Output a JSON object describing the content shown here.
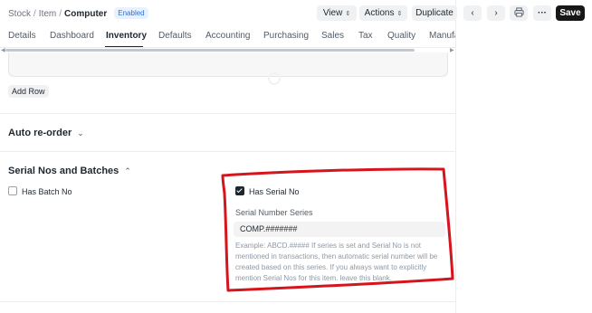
{
  "breadcrumb": {
    "items": [
      "Stock",
      "Item",
      "Computer"
    ],
    "status_badge": "Enabled"
  },
  "toolbar": {
    "view_label": "View",
    "actions_label": "Actions",
    "duplicate_label": "Duplicate",
    "save_label": "Save",
    "icons": [
      "chevron-left-icon",
      "chevron-right-icon",
      "printer-icon",
      "more-icon"
    ]
  },
  "tabs": [
    {
      "label": "Details"
    },
    {
      "label": "Dashboard"
    },
    {
      "label": "Inventory",
      "active": true
    },
    {
      "label": "Defaults"
    },
    {
      "label": "Accounting"
    },
    {
      "label": "Purchasing"
    },
    {
      "label": "Sales"
    },
    {
      "label": "Tax"
    },
    {
      "label": "Quality"
    },
    {
      "label": "Manufa"
    }
  ],
  "grid": {
    "add_row_label": "Add Row"
  },
  "sections": {
    "auto_reorder": {
      "title": "Auto re-order",
      "expanded": false
    },
    "serial_batches": {
      "title": "Serial Nos and Batches",
      "expanded": true,
      "has_batch_no": {
        "label": "Has Batch No",
        "checked": false
      },
      "has_serial_no": {
        "label": "Has Serial No",
        "checked": true
      },
      "serial_number_series": {
        "label": "Serial Number Series",
        "value": "COMP.#######",
        "help": "Example: ABCD.##### If series is set and Serial No is not mentioned in transactions, then automatic serial number will be created based on this series. If you always want to explicitly mention Serial Nos for this item. leave this blank."
      }
    }
  },
  "colors": {
    "annotation": "#d6141c",
    "save_button": "#171717",
    "badge_text": "#2e6fd6",
    "badge_bg": "#e8f2ff"
  }
}
